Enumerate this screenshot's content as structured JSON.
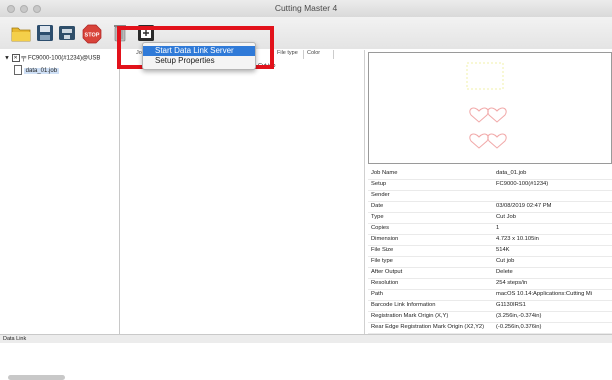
{
  "window": {
    "title": "Cutting Master 4"
  },
  "toolbar": {
    "buttons": [
      {
        "name": "open-icon"
      },
      {
        "name": "save-icon"
      },
      {
        "name": "cutter-icon"
      },
      {
        "name": "stop-icon"
      },
      {
        "name": "trash-icon"
      },
      {
        "name": "data-link-icon"
      }
    ]
  },
  "menu": {
    "items": [
      {
        "label": "Start Data Link Server",
        "selected": true
      },
      {
        "label": "Setup Properties",
        "selected": false
      }
    ]
  },
  "tree": {
    "device": "FC9000-100(#1234)@USB",
    "job": "data_01.job"
  },
  "columns": {
    "filetype": "File type",
    "color": "Color",
    "first": "Jo"
  },
  "job_list": {
    "cell": "Cut job"
  },
  "props": [
    {
      "k": "Job Name",
      "v": "data_01.job"
    },
    {
      "k": "Setup",
      "v": "FC9000-100(#1234)"
    },
    {
      "k": "Sender",
      "v": ""
    },
    {
      "k": "Date",
      "v": "03/08/2019 02:47 PM"
    },
    {
      "k": "Type",
      "v": "Cut Job"
    },
    {
      "k": "Copies",
      "v": "1"
    },
    {
      "k": "Dimension",
      "v": "4.723 x 10.105in"
    },
    {
      "k": "File Size",
      "v": "514K"
    },
    {
      "k": "File type",
      "v": "Cut job"
    },
    {
      "k": "After Output",
      "v": "Delete"
    },
    {
      "k": "Resolution",
      "v": "254 steps/in"
    },
    {
      "k": "Path",
      "v": "macOS 10.14:Applications:Cutting Mi"
    },
    {
      "k": "Barcode Link Information",
      "v": "G1130IRS1"
    },
    {
      "k": "Registration Mark Origin (X,Y)",
      "v": "(3.256in,-0.374in)"
    },
    {
      "k": "Rear Edge Registration Mark Origin (X2,Y2)",
      "v": "(-0.256in,0.376in)"
    }
  ],
  "status": {
    "text": "Data Link"
  },
  "colors": {
    "highlight": "#e2121b",
    "menu_selected": "#2f7ad8"
  }
}
